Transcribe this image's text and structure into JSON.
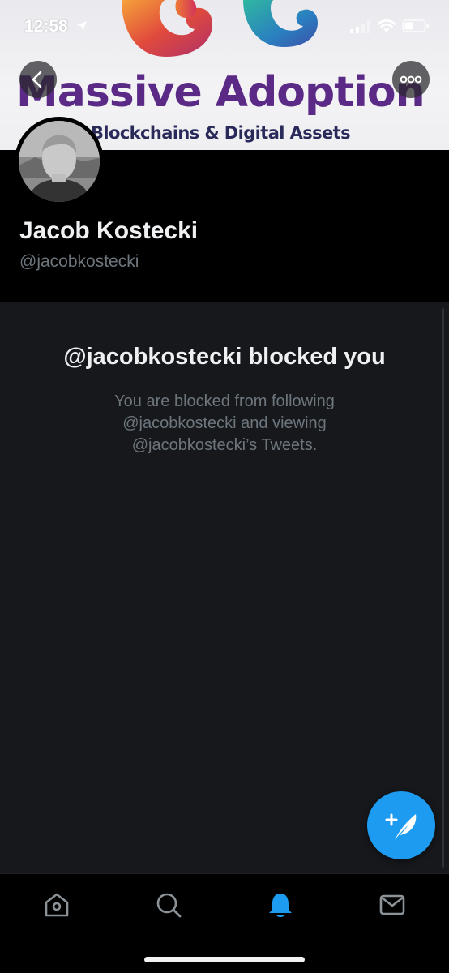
{
  "status_bar": {
    "time": "12:58"
  },
  "banner": {
    "title": "Massive Adoption",
    "subtitle": "Blockchains & Digital Assets"
  },
  "profile": {
    "name": "Jacob Kostecki",
    "handle": "@jacobkostecki"
  },
  "blocked": {
    "title": "@jacobkostecki blocked you",
    "line1": "You are blocked from following",
    "line2": "@jacobkostecki and viewing",
    "line3": "@jacobkostecki’s Tweets."
  },
  "tabs": [
    {
      "icon": "home-icon",
      "active": false
    },
    {
      "icon": "search-icon",
      "active": false
    },
    {
      "icon": "bell-icon",
      "active": true
    },
    {
      "icon": "mail-icon",
      "active": false
    }
  ],
  "colors": {
    "accent": "#1d9bf0",
    "background": "#000000",
    "panel": "#16181c",
    "secondary_text": "#6e767d",
    "banner_title": "#5b2a86"
  }
}
